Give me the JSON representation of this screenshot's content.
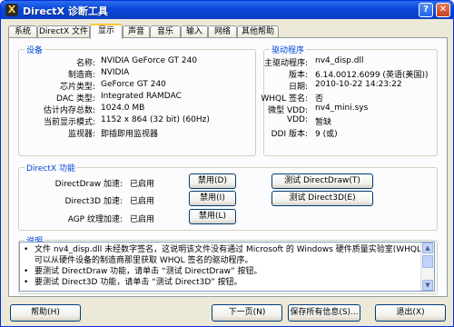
{
  "window": {
    "title": "DirectX 诊断工具",
    "help_btn": "?",
    "close_btn": "✕"
  },
  "tabs": [
    "系统",
    "DirectX 文件",
    "显示",
    "声音",
    "音乐",
    "输入",
    "网络",
    "其他帮助"
  ],
  "device": {
    "title": "设备",
    "rows": [
      {
        "label": "名称:",
        "value": "NVIDIA GeForce GT 240"
      },
      {
        "label": "制造商:",
        "value": "NVIDIA"
      },
      {
        "label": "芯片类型:",
        "value": "GeForce GT 240"
      },
      {
        "label": "DAC 类型:",
        "value": "Integrated RAMDAC"
      },
      {
        "label": "估计内存总数:",
        "value": "1024.0 MB"
      },
      {
        "label": "当前显示模式:",
        "value": "1152 x 864 (32 bit) (60Hz)"
      },
      {
        "label": "监视器:",
        "value": "即插即用监视器"
      }
    ]
  },
  "driver": {
    "title": "驱动程序",
    "rows": [
      {
        "label": "主驱动程序:",
        "value": "nv4_disp.dll"
      },
      {
        "label": "版本:",
        "value": "6.14.0012.6099 (英语(美国))"
      },
      {
        "label": "日期:",
        "value": "2010-10-22 14:23:22"
      },
      {
        "label": "WHQL 签名:",
        "value": "否"
      },
      {
        "label": "微型 VDD:",
        "value": "nv4_mini.sys"
      },
      {
        "label": "VDD:",
        "value": "暂缺"
      },
      {
        "label": "DDI 版本:",
        "value": "9 (或)"
      }
    ]
  },
  "features": {
    "title": "DirectX 功能",
    "rows": [
      {
        "label": "DirectDraw 加速:",
        "status": "已启用",
        "button": "禁用(D)"
      },
      {
        "label": "Direct3D 加速:",
        "status": "已启用",
        "button": "禁用(I)"
      },
      {
        "label": "AGP 纹理加速:",
        "status": "已启用",
        "button": "禁用(L)"
      }
    ],
    "test_directdraw": "测试 DirectDraw(T)",
    "test_direct3d": "测试 Direct3D(E)"
  },
  "notes": {
    "title": "说明",
    "lines": [
      {
        "bullet": "•",
        "text": "文件 nv4_disp.dll 未经数字签名，这说明该文件没有通过 Microsoft 的 Windows 硬件质量实验室(WHQL)测试。您"
      },
      {
        "bullet": "",
        "text": "可以从硬件设备的制造商那里获取 WHQL 签名的驱动程序。"
      },
      {
        "bullet": "•",
        "text": "要测试 DirectDraw 功能，请单击 “测试 DirectDraw” 按钮。"
      },
      {
        "bullet": "•",
        "text": "要测试 Direct3D 功能，请单击 “测试 Direct3D” 按钮。"
      }
    ]
  },
  "bottom": {
    "help": "帮助(H)",
    "next": "下一页(N)",
    "save": "保存所有信息(S)...",
    "exit": "退出(X)"
  }
}
